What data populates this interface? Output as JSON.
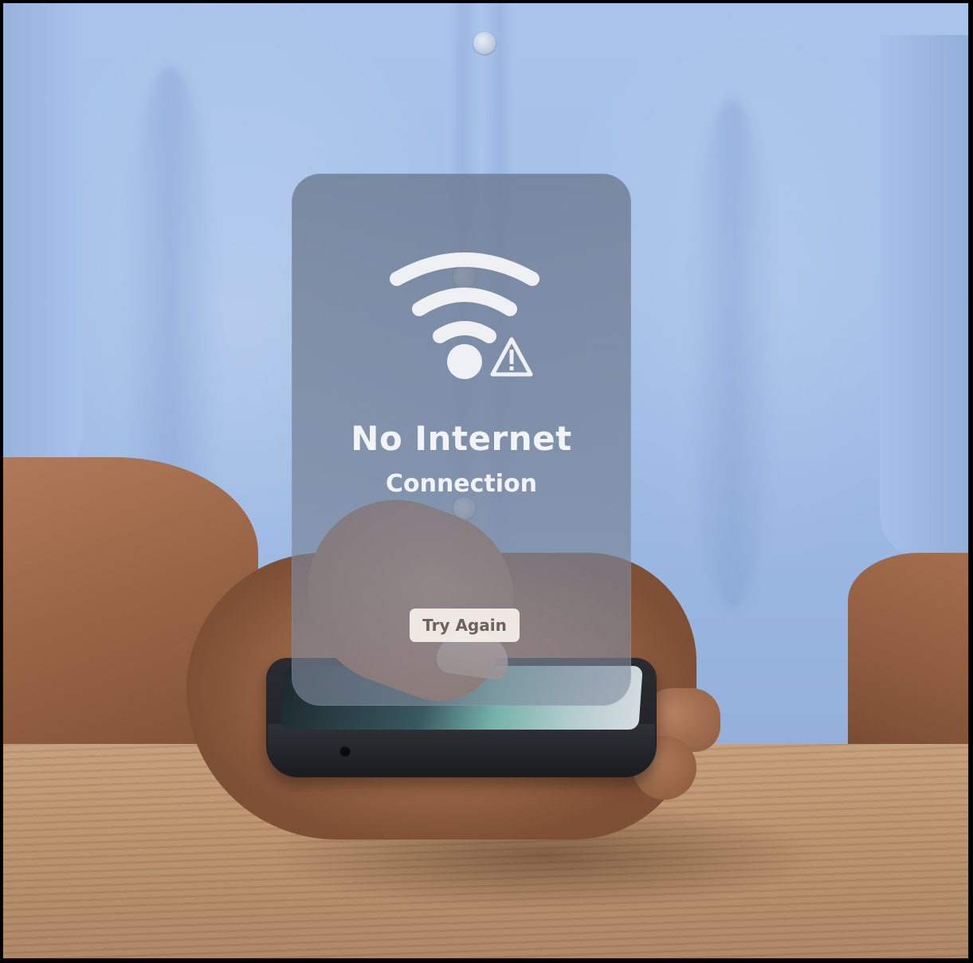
{
  "dialog": {
    "title": "No Internet",
    "subtitle": "Connection",
    "retry_button_label": "Try Again",
    "icon": "wifi-warning-icon"
  },
  "colors": {
    "card_background": "#6c788e",
    "text": "#f2f3f6",
    "button_background": "#f6f1ec",
    "button_text": "#6f625a",
    "shirt": "#a9c4ea"
  }
}
